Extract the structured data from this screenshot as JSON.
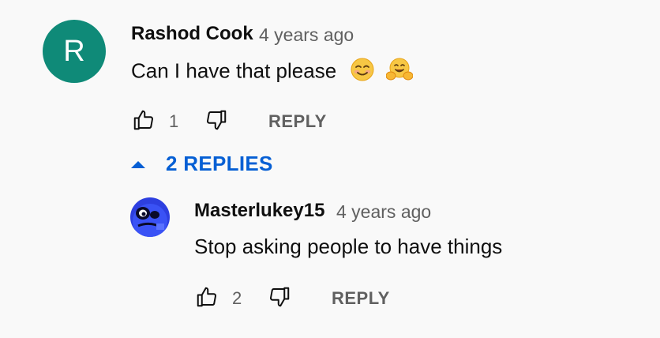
{
  "comment": {
    "avatar_letter": "R",
    "author": "Rashod Cook",
    "time": "4 years ago",
    "text": "Can I have that please",
    "emojis": [
      "smiling-face-emoji",
      "hugging-face-emoji"
    ],
    "like_count": "1",
    "reply_label": "REPLY"
  },
  "replies_toggle": {
    "label": "2 REPLIES"
  },
  "reply": {
    "author": "Masterlukey15",
    "time": "4 years ago",
    "text": "Stop asking people to have things",
    "like_count": "2",
    "reply_label": "REPLY"
  },
  "colors": {
    "avatar_bg": "#0f8a78",
    "link_blue": "#065fd4",
    "secondary_text": "#606060",
    "background": "#f9f9f9"
  }
}
